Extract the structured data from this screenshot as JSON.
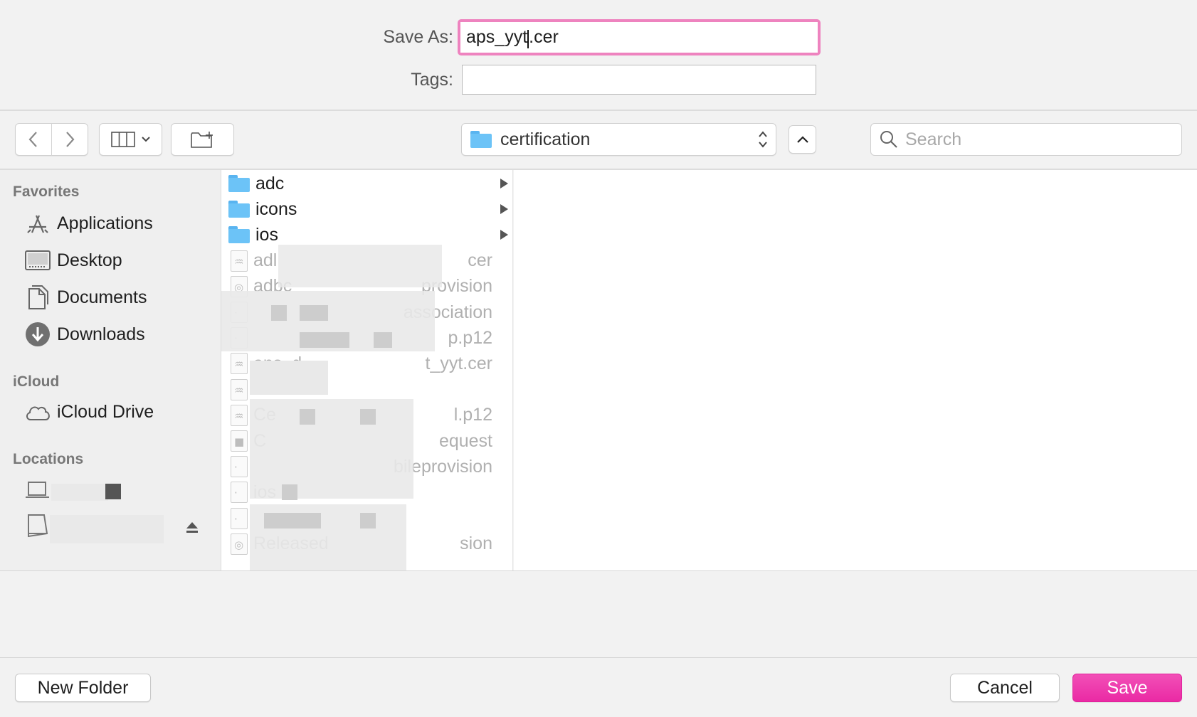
{
  "form": {
    "save_as_label": "Save As:",
    "save_as_before_caret": "aps_yyt",
    "save_as_after_caret": ".cer",
    "tags_label": "Tags:",
    "tags_value": ""
  },
  "toolbar": {
    "location_name": "certification",
    "search_placeholder": "Search"
  },
  "sidebar": {
    "favorites_header": "Favorites",
    "favorites": [
      {
        "label": "Applications",
        "icon": "applications-icon"
      },
      {
        "label": "Desktop",
        "icon": "desktop-icon"
      },
      {
        "label": "Documents",
        "icon": "documents-icon"
      },
      {
        "label": "Downloads",
        "icon": "downloads-icon"
      }
    ],
    "icloud_header": "iCloud",
    "icloud": [
      {
        "label": "iCloud Drive",
        "icon": "cloud-icon"
      }
    ],
    "locations_header": "Locations"
  },
  "files": [
    {
      "name": "adc",
      "type": "folder"
    },
    {
      "name": "icons",
      "type": "folder"
    },
    {
      "name": "ios",
      "type": "folder"
    },
    {
      "name": "adl",
      "suffix": "cer",
      "type": "certificate"
    },
    {
      "name": "adbc",
      "suffix": "provision",
      "type": "provision"
    },
    {
      "name": "",
      "suffix": "association",
      "type": "file"
    },
    {
      "name": "",
      "suffix": "p.p12",
      "type": "file"
    },
    {
      "name": "aps_d",
      "suffix": "t_yyt.cer",
      "type": "certificate"
    },
    {
      "name": "",
      "suffix": "",
      "type": "certificate"
    },
    {
      "name": "Ce",
      "suffix": "l.p12",
      "type": "certificate"
    },
    {
      "name": "C",
      "suffix": "equest",
      "type": "request"
    },
    {
      "name": "",
      "suffix": "bileprovision",
      "type": "file"
    },
    {
      "name": "ios",
      "suffix": "",
      "type": "file"
    },
    {
      "name": "",
      "suffix": "",
      "type": "file"
    },
    {
      "name": "Released",
      "suffix": "sion",
      "type": "provision"
    }
  ],
  "buttons": {
    "new_folder": "New Folder",
    "cancel": "Cancel",
    "save": "Save"
  },
  "colors": {
    "accent": "#ea2aa4",
    "focus_ring": "#ee83bf",
    "folder": "#6cc3f7"
  }
}
